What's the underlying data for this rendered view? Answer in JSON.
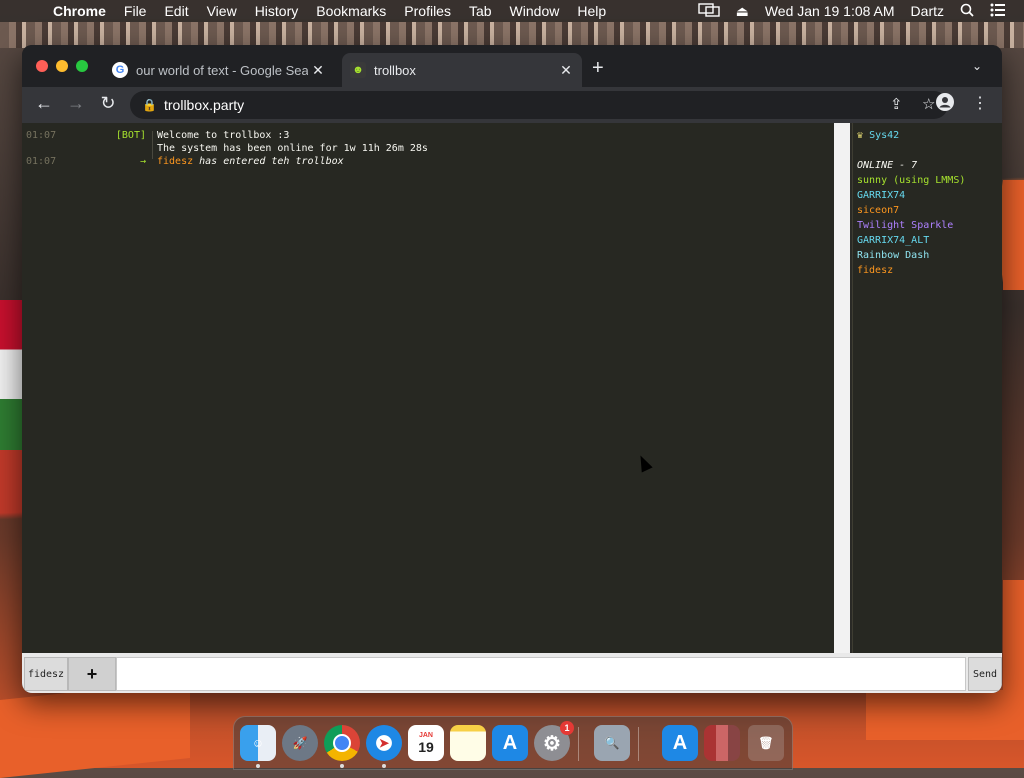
{
  "menubar": {
    "app_name": "Chrome",
    "items": [
      "File",
      "Edit",
      "View",
      "History",
      "Bookmarks",
      "Profiles",
      "Tab",
      "Window",
      "Help"
    ],
    "datetime": "Wed Jan 19  1:08 AM",
    "user": "Dartz"
  },
  "browser": {
    "tabs": [
      {
        "title": "our world of text - Google Sear",
        "favicon": "google-icon",
        "active": false
      },
      {
        "title": "trollbox",
        "favicon": "trollbox-icon",
        "active": true
      }
    ],
    "url": "trollbox.party"
  },
  "chat": {
    "messages": [
      {
        "time": "01:07",
        "nick": "[BOT]",
        "nick_color": "#a6e22e",
        "lines": [
          "Welcome to trollbox :3",
          "The system has been online for 1w 11h 26m 28s"
        ]
      },
      {
        "time": "01:07",
        "nick": "→",
        "nick_color": "#a6e22e",
        "actor": "fidesz",
        "actor_color": "#fd971f",
        "text": " has entered teh trollbox"
      }
    ]
  },
  "users": {
    "self": "Sys42",
    "online_label": "ONLINE - 7",
    "list": [
      {
        "name": "sunny (using LMMS)",
        "color": "#a6e22e"
      },
      {
        "name": "GARRIX74",
        "color": "#66d9ef"
      },
      {
        "name": "siceon7",
        "color": "#fd971f"
      },
      {
        "name": "Twilight Sparkle",
        "color": "#ae81ff"
      },
      {
        "name": "GARRIX74_ALT",
        "color": "#66d9ef"
      },
      {
        "name": "Rainbow Dash",
        "color": "#8fe3f0"
      },
      {
        "name": "fidesz",
        "color": "#fd971f"
      }
    ]
  },
  "input": {
    "nick": "fidesz",
    "plus": "+",
    "send": "Send",
    "value": ""
  },
  "dock": {
    "calendar_month": "JAN",
    "calendar_day": "19",
    "settings_badge": "1"
  }
}
